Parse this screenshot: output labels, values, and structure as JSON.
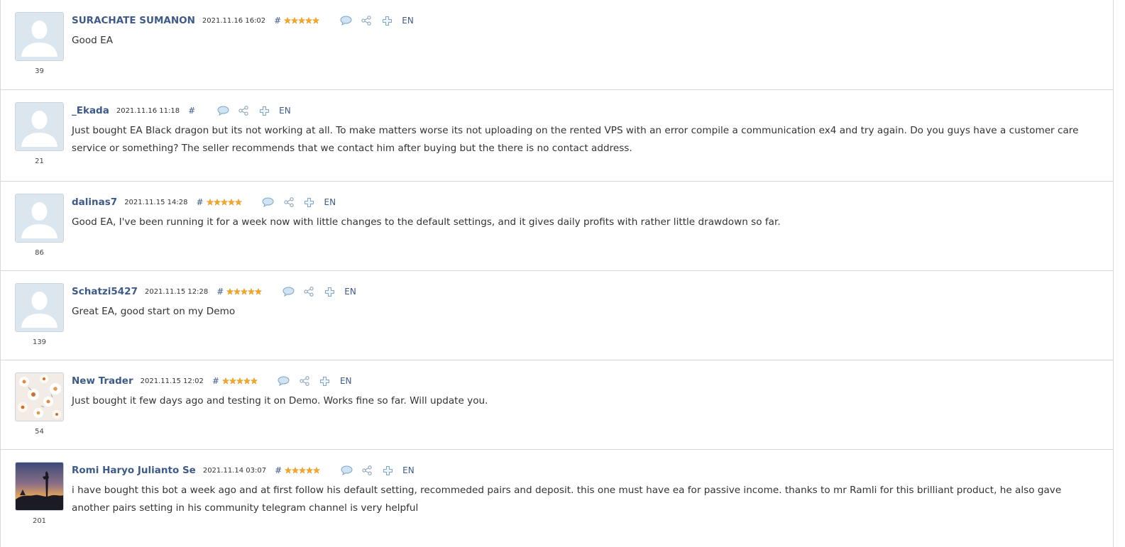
{
  "reviews": [
    {
      "author": "SURACHATE SUMANON",
      "rank": "39",
      "date": "2021.11.16 16:02",
      "hash": "#",
      "rating": 5,
      "lang": "EN",
      "avatar": "default-avatar",
      "text": "Good EA"
    },
    {
      "author": "_Ekada",
      "rank": "21",
      "date": "2021.11.16 11:18",
      "hash": "#",
      "rating": 0,
      "lang": "EN",
      "avatar": "default-avatar",
      "text": "Just bought EA Black dragon but its not working at all. To make matters worse its not uploading on the rented VPS with an error compile a communication ex4 and try again. Do you guys have a customer care service or something? The seller recommends that we contact him after buying but the there is no contact address."
    },
    {
      "author": "dalinas7",
      "rank": "86",
      "date": "2021.11.15 14:28",
      "hash": "#",
      "rating": 5,
      "lang": "EN",
      "avatar": "default-avatar",
      "text": "Good EA, I've been running it for a week now with little changes to the default settings, and it gives daily profits with rather little drawdown so far."
    },
    {
      "author": "Schatzi5427",
      "rank": "139",
      "date": "2021.11.15 12:28",
      "hash": "#",
      "rating": 5,
      "lang": "EN",
      "avatar": "default-avatar",
      "text": "Great EA, good start on my Demo"
    },
    {
      "author": "New Trader",
      "rank": "54",
      "date": "2021.11.15 12:02",
      "hash": "#",
      "rating": 5,
      "lang": "EN",
      "avatar": "flowers-photo-avatar",
      "text": "Just bought it few days ago and testing it on Demo. Works fine so far. Will update you."
    },
    {
      "author": "Romi Haryo Julianto Se",
      "rank": "201",
      "date": "2021.11.14 03:07",
      "hash": "#",
      "rating": 5,
      "lang": "EN",
      "avatar": "sunset-photo-avatar",
      "text": "i have bought this bot a week ago and at first follow his default setting, recommeded pairs and deposit. this one must have ea for passive income. thanks to mr Ramli for this brilliant product, he also gave another pairs setting in his community telegram channel is very helpful"
    }
  ],
  "icons": {
    "reply": "speech-bubble-icon",
    "share": "share-icon",
    "add": "plus-icon"
  },
  "colors": {
    "author": "#3d5a8a",
    "star": "#f5a623",
    "divider": "#d6d6d6",
    "avatar_bg": "#dbe6ee"
  }
}
